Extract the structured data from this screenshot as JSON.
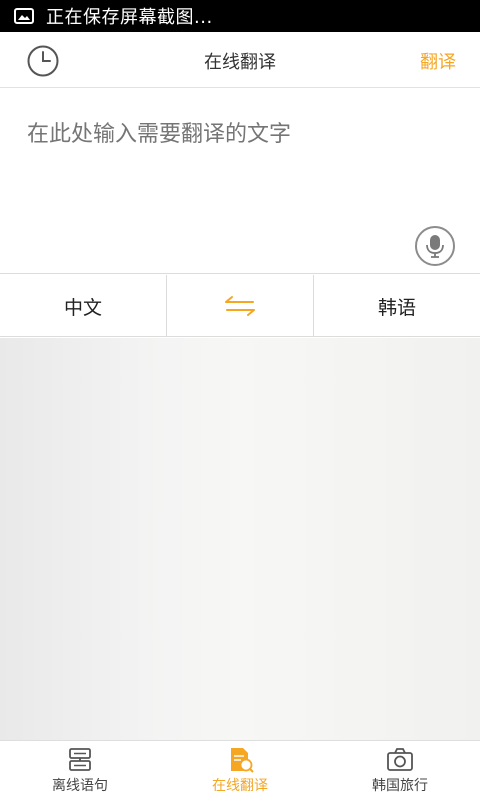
{
  "status_bar": {
    "text": "正在保存屏幕截图...",
    "icon": "image-icon"
  },
  "header": {
    "title": "在线翻译",
    "translate_label": "翻译",
    "history_icon": "clock-icon"
  },
  "input": {
    "placeholder": "在此处输入需要翻译的文字",
    "mic_icon": "microphone-icon"
  },
  "languages": {
    "source": "中文",
    "target": "韩语",
    "swap_icon": "swap-arrows-icon"
  },
  "bottom_nav": {
    "items": [
      {
        "label": "离线语句",
        "icon": "phrasebook-icon",
        "active": false
      },
      {
        "label": "在线翻译",
        "icon": "translate-document-icon",
        "active": true
      },
      {
        "label": "韩国旅行",
        "icon": "camera-icon",
        "active": false
      }
    ]
  },
  "colors": {
    "accent": "#f5a623",
    "status_bar_bg": "#000000",
    "text_primary": "#222222",
    "placeholder": "#9a9a9a"
  }
}
